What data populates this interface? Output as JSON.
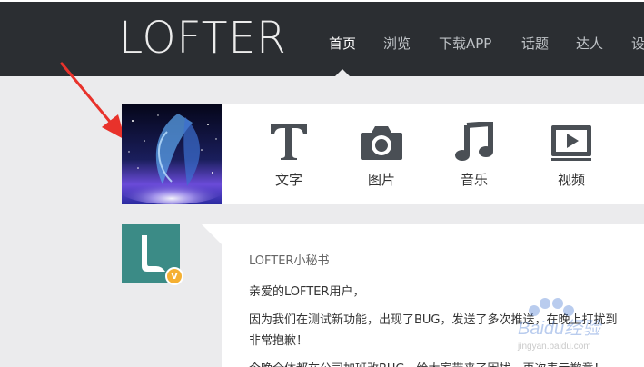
{
  "header": {
    "logo": "LOFTER",
    "nav": [
      {
        "label": "首页",
        "active": true
      },
      {
        "label": "浏览",
        "active": false
      },
      {
        "label": "下载APP",
        "active": false
      },
      {
        "label": "话题",
        "active": false
      },
      {
        "label": "达人",
        "active": false
      },
      {
        "label": "设",
        "active": false
      }
    ]
  },
  "publish": {
    "items": [
      {
        "label": "文字",
        "icon": "text-icon"
      },
      {
        "label": "图片",
        "icon": "camera-icon"
      },
      {
        "label": "音乐",
        "icon": "music-icon"
      },
      {
        "label": "视频",
        "icon": "video-icon"
      }
    ]
  },
  "post": {
    "author": "LOFTER小秘书",
    "verified_badge": "v",
    "lines": [
      "亲爱的LOFTER用户，",
      "因为我们在测试新功能，出现了BUG，发送了多次推送，在晚上打扰到",
      "非常抱歉！",
      "今晚全体都在公司加班改BUG，给大家带来了困扰，再次表示歉意！"
    ]
  },
  "watermark": {
    "text": "Baidu经验",
    "url": "jingyan.baidu.com"
  },
  "colors": {
    "header_bg": "#2b2e32",
    "page_bg": "#ebebed",
    "icon": "#4a4f55",
    "arrow": "#e8322b",
    "avatar_green": "#3b8b86",
    "badge": "#f5b032"
  }
}
